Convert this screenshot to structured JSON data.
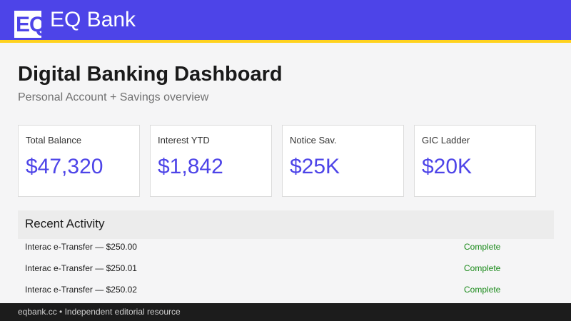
{
  "header": {
    "logo_text": "EQ",
    "brand": "EQ Bank"
  },
  "colors": {
    "brand": "#4d44e8",
    "accent_stripe": "#ffd21f",
    "status_complete": "#1a8a1a"
  },
  "main": {
    "title": "Digital Banking Dashboard",
    "subtitle": "Personal Account + Savings overview"
  },
  "cards": [
    {
      "label": "Total Balance",
      "value": "$47,320"
    },
    {
      "label": "Interest YTD",
      "value": "$1,842"
    },
    {
      "label": "Notice Sav.",
      "value": "$25K"
    },
    {
      "label": "GIC Ladder",
      "value": "$20K"
    }
  ],
  "activity": {
    "title": "Recent Activity",
    "rows": [
      {
        "description": "Interac e-Transfer — $250.00",
        "status": "Complete"
      },
      {
        "description": "Interac e-Transfer — $250.01",
        "status": "Complete"
      },
      {
        "description": "Interac e-Transfer — $250.02",
        "status": "Complete"
      }
    ]
  },
  "footer": {
    "text": "eqbank.cc • Independent editorial resource"
  }
}
